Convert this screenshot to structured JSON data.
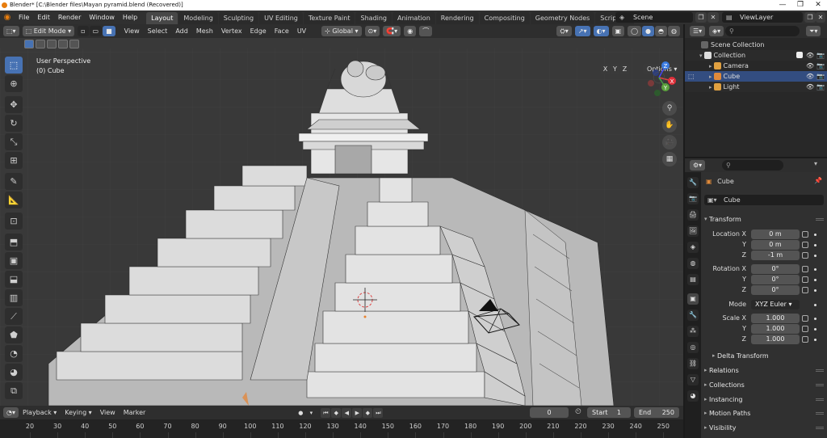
{
  "window": {
    "title": "Blender* [C:\\Blender files\\Mayan pyramid.blend (Recovered)]",
    "controls": [
      "—",
      "❐",
      "✕"
    ]
  },
  "menu": [
    "File",
    "Edit",
    "Render",
    "Window",
    "Help"
  ],
  "workspaces": [
    "Layout",
    "Modeling",
    "Sculpting",
    "UV Editing",
    "Texture Paint",
    "Shading",
    "Animation",
    "Rendering",
    "Compositing",
    "Geometry Nodes",
    "Scripting"
  ],
  "workspace_add": "+",
  "scene_name": "Scene",
  "view_layer": "ViewLayer",
  "viewport": {
    "mode": "Edit Mode",
    "menus": [
      "View",
      "Select",
      "Add",
      "Mesh",
      "Vertex",
      "Edge",
      "Face",
      "UV"
    ],
    "orientation": "Global",
    "overlay_title": "User Perspective",
    "overlay_object": "(0) Cube",
    "options_label": "Options",
    "mirror_axes": [
      "X",
      "Y",
      "Z"
    ],
    "gizmo_axes": {
      "x": "X",
      "y": "Y",
      "z": "Z"
    },
    "accent": "#4772b3"
  },
  "timeline": {
    "menus": [
      "Playback",
      "Keying",
      "View",
      "Marker"
    ],
    "current_frame": "0",
    "start_label": "Start",
    "start_value": "1",
    "end_label": "End",
    "end_value": "250",
    "ticks": [
      "20",
      "30",
      "40",
      "50",
      "60",
      "70",
      "80",
      "90",
      "100",
      "110",
      "120",
      "130",
      "140",
      "150",
      "160",
      "170",
      "180",
      "190",
      "200",
      "210",
      "220",
      "230",
      "240",
      "250"
    ]
  },
  "outliner": {
    "root": "Scene Collection",
    "collection": "Collection",
    "items": [
      {
        "name": "Camera",
        "color": "#e0a040"
      },
      {
        "name": "Cube",
        "color": "#e08a3a"
      },
      {
        "name": "Light",
        "color": "#e0a040"
      }
    ]
  },
  "properties": {
    "object_name": "Cube",
    "mesh_name": "Cube",
    "transform_label": "Transform",
    "location_label": "Location X",
    "rotation_label": "Rotation X",
    "scale_label": "Scale X",
    "axis_y": "Y",
    "axis_z": "Z",
    "location": [
      "0 m",
      "0 m",
      "-1 m"
    ],
    "rotation": [
      "0°",
      "0°",
      "0°"
    ],
    "mode_label": "Mode",
    "mode_value": "XYZ Euler",
    "scale": [
      "1.000",
      "1.000",
      "1.000"
    ],
    "delta_transform": "Delta Transform",
    "panels": [
      "Relations",
      "Collections",
      "Instancing",
      "Motion Paths",
      "Visibility"
    ]
  }
}
